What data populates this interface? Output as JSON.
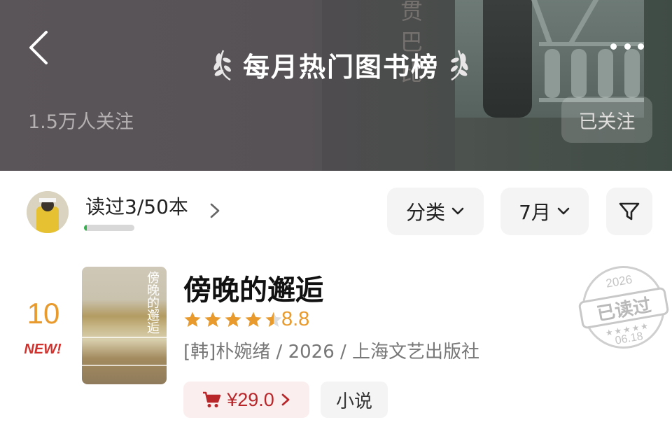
{
  "header": {
    "title": "每月热门图书榜",
    "followers": "1.5万人关注",
    "follow_button": "已关注",
    "background_text": "贯巴比"
  },
  "reading_progress": {
    "label": "读过3/50本",
    "read": 3,
    "total": 50
  },
  "filters": {
    "category": "分类",
    "month": "7月"
  },
  "book": {
    "rank": "10",
    "badge": "NEW!",
    "title": "傍晚的邂逅",
    "cover_title": "傍晚的邂逅",
    "rating": "8.8",
    "stars": 4.5,
    "meta": "[韩]朴婉绪 / 2026 / 上海文艺出版社",
    "price": "¥29.0",
    "genre": "小说",
    "stamp": {
      "year": "2026",
      "label": "已读过",
      "date": "06.18"
    }
  },
  "icons": {
    "back": "back-chevron-icon",
    "more": "more-dots-icon",
    "laurel": "laurel-icon",
    "filter": "funnel-icon",
    "cart": "shopping-cart-icon",
    "star": "star-icon"
  },
  "colors": {
    "accent_orange": "#e89a2c",
    "new_red": "#d0312d",
    "price_red": "#b8262a",
    "progress_green": "#35b04f"
  }
}
